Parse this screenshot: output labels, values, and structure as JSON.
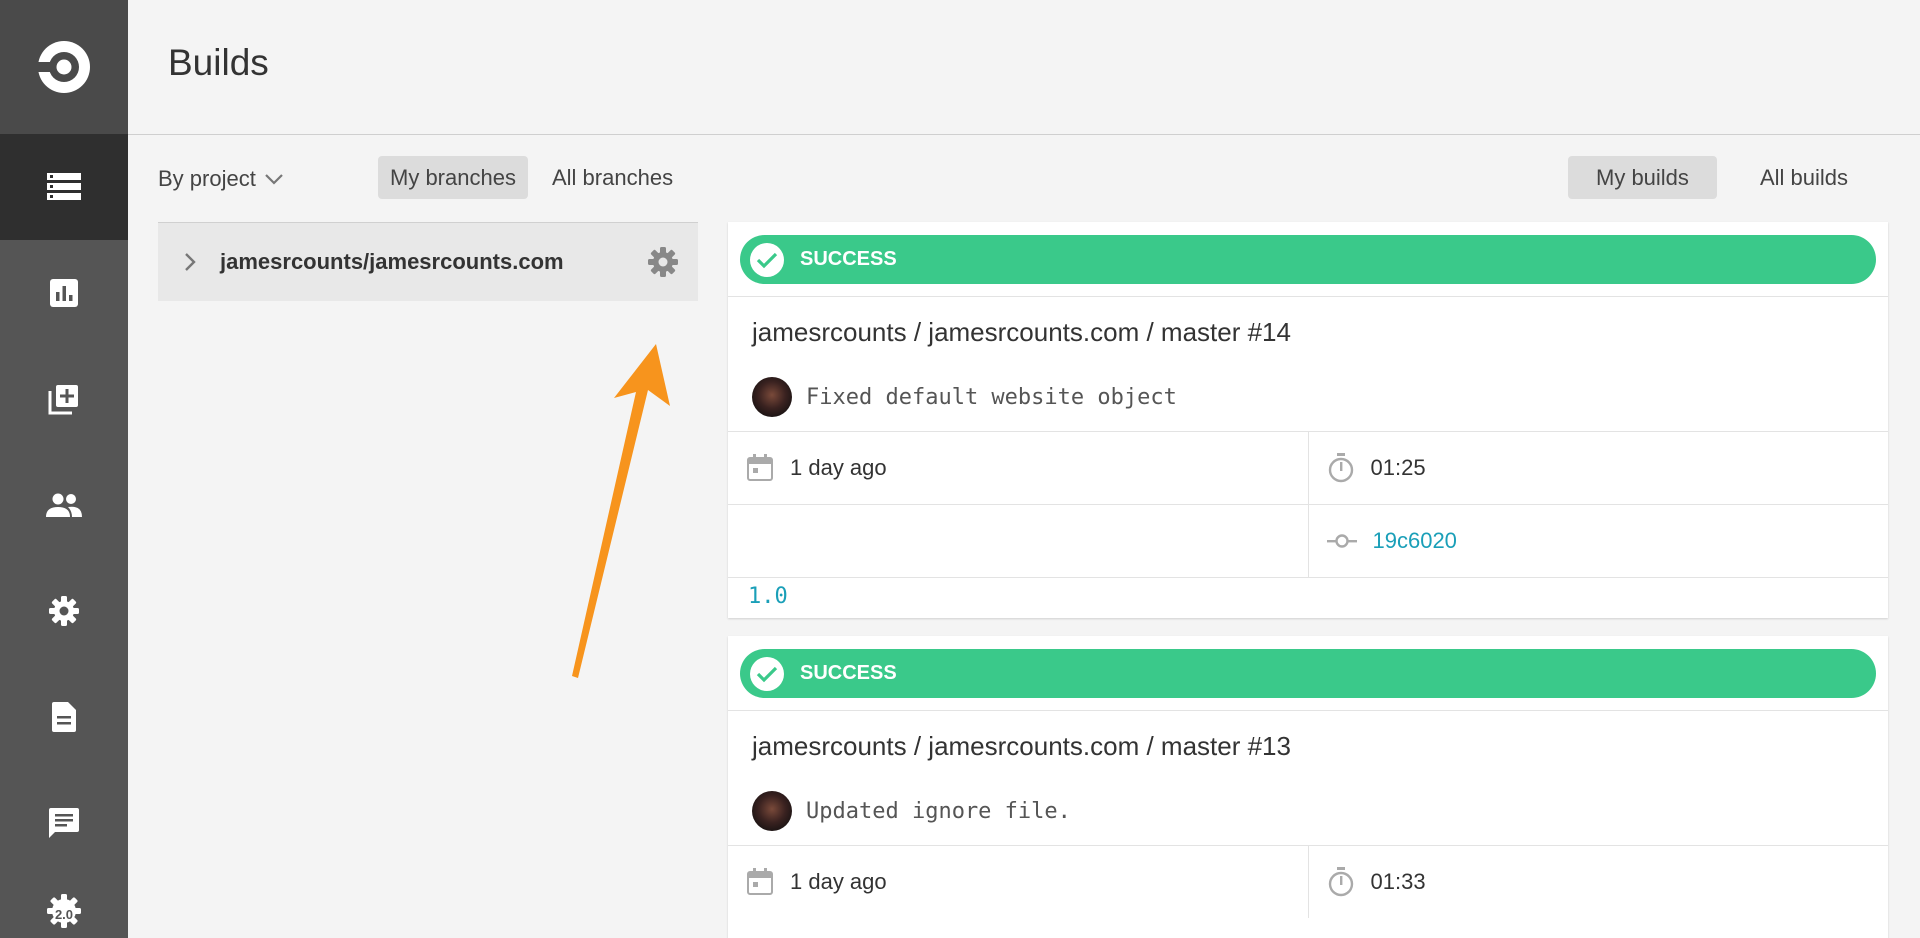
{
  "app": {
    "brand_color": "#555555",
    "success_color": "#3ac98a",
    "link_color": "#1a9fb8"
  },
  "sidebar": {
    "logo_icon": "circleci-logo-icon",
    "items": [
      {
        "name": "builds",
        "icon": "builds-list-icon",
        "active": true
      },
      {
        "name": "insights",
        "icon": "insights-chart-icon",
        "active": false
      },
      {
        "name": "add-projects",
        "icon": "add-projects-icon",
        "active": false
      },
      {
        "name": "team",
        "icon": "team-icon",
        "active": false
      },
      {
        "name": "settings",
        "icon": "gear-icon",
        "active": false
      },
      {
        "name": "docs",
        "icon": "document-icon",
        "active": false
      },
      {
        "name": "support",
        "icon": "chat-icon",
        "active": false
      },
      {
        "name": "circleci-2",
        "icon": "gear-2-0-icon",
        "label": "2.0",
        "active": false
      }
    ]
  },
  "header": {
    "title": "Builds"
  },
  "filters": {
    "by_project": "By project",
    "branch_toggle": [
      "My branches",
      "All branches"
    ],
    "branch_selected": "My branches",
    "build_toggle": [
      "My builds",
      "All builds"
    ],
    "build_selected": "My builds"
  },
  "project": {
    "name": "jamesrcounts/jamesrcounts.com"
  },
  "builds": [
    {
      "status": "SUCCESS",
      "title": "jamesrcounts / jamesrcounts.com / master #14",
      "commit_message": "Fixed default website object",
      "time_ago": "1 day ago",
      "duration": "01:25",
      "sha": "19c6020",
      "tag": "1.0"
    },
    {
      "status": "SUCCESS",
      "title": "jamesrcounts / jamesrcounts.com / master #13",
      "commit_message": "Updated ignore file.",
      "time_ago": "1 day ago",
      "duration": "01:33"
    }
  ]
}
